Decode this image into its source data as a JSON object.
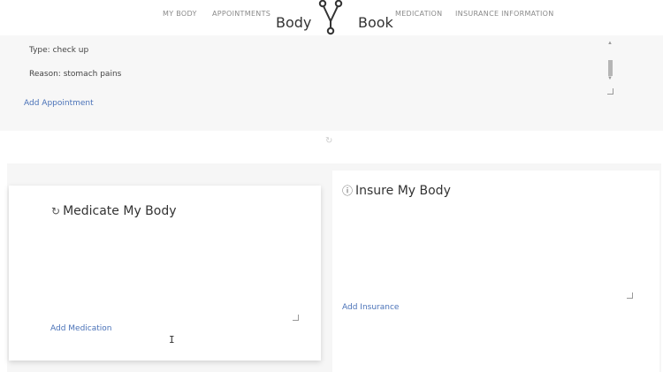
{
  "header": {
    "nav_left": [
      "MY BODY",
      "APPOINTMENTS"
    ],
    "nav_right": [
      "MEDICATION",
      "INSURANCE INFORMATION"
    ],
    "brand_left": "Body",
    "brand_right": "Book",
    "logo_icon": "fork-y-logo-icon"
  },
  "appointment": {
    "type_line": "Type: check up",
    "reason_line": "Reason: stomach pains",
    "add_link": "Add Appointment"
  },
  "medication": {
    "title": "Medicate My Body",
    "icon": "refresh-icon",
    "add_link": "Add Medication"
  },
  "insurance": {
    "title": "Insure My Body",
    "icon": "info-circle-icon",
    "add_link": "Add Insurance"
  },
  "colors": {
    "link": "#4a72b8",
    "panel_bg": "#f7f7f7",
    "card_bg": "#ffffff"
  }
}
